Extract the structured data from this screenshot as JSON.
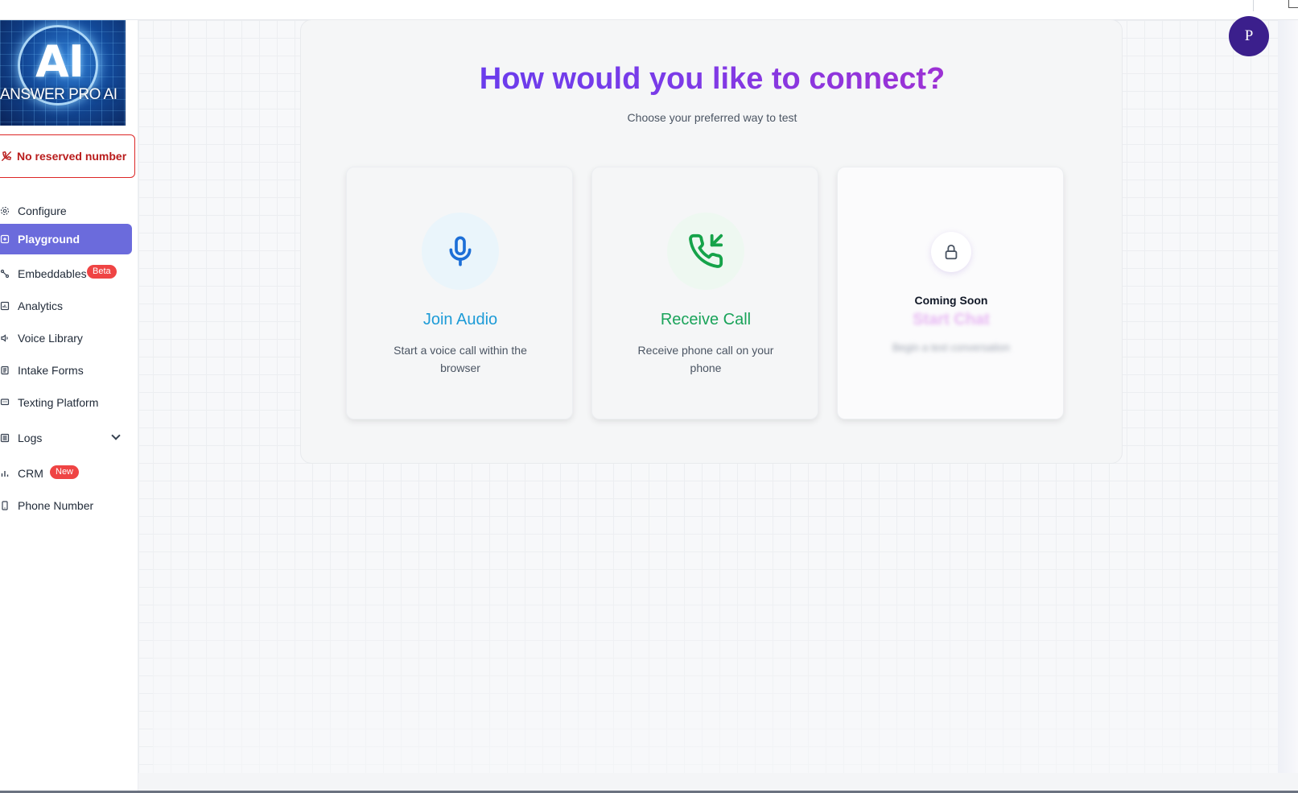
{
  "sidebar": {
    "logo": {
      "mark": "AI",
      "text": "ANSWER PRO AI"
    },
    "reserved_number": "No reserved number",
    "items": [
      {
        "label": "Configure",
        "icon": "gear-icon"
      },
      {
        "label": "Playground",
        "icon": "plus-square-icon",
        "active": true
      },
      {
        "label": "Embeddables",
        "icon": "nodes-icon",
        "badge": "Beta"
      },
      {
        "label": "Analytics",
        "icon": "chart-icon"
      },
      {
        "label": "Voice Library",
        "icon": "speaker-icon"
      },
      {
        "label": "Intake Forms",
        "icon": "document-icon"
      },
      {
        "label": "Texting Platform",
        "icon": "message-icon"
      },
      {
        "label": "Logs",
        "icon": "list-icon"
      },
      {
        "label": "CRM",
        "icon": "bars-icon",
        "badge": "New"
      },
      {
        "label": "Phone Number",
        "icon": "phone-icon"
      }
    ]
  },
  "header": {
    "avatar_initial": "P"
  },
  "main": {
    "title": "How would you like to connect?",
    "subtitle": "Choose your preferred way to test",
    "cards": [
      {
        "title": "Join Audio",
        "description": "Start a voice call within the browser",
        "icon": "microphone-icon",
        "accent": "#1d9bd7"
      },
      {
        "title": "Receive Call",
        "description": "Receive phone call on your phone",
        "icon": "phone-incoming-icon",
        "accent": "#1aa35a"
      },
      {
        "title": "Start Chat",
        "description": "Begin a text conversation",
        "status": "Coming Soon",
        "icon": "lock-icon",
        "locked": true
      }
    ]
  },
  "colors": {
    "active_nav": "#6b6bdc",
    "badge": "#ef4444",
    "reserved_border": "#dc2626",
    "avatar": "#3b1f8c",
    "title_gradient_start": "#5b3ef0",
    "title_gradient_end": "#b32bc7"
  }
}
